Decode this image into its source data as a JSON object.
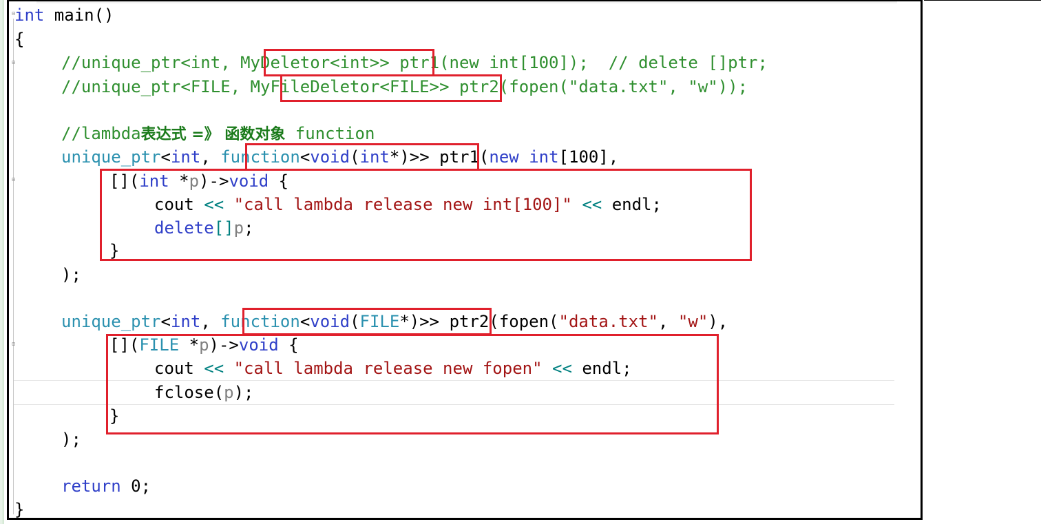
{
  "editor": {
    "language": "cpp",
    "lines": {
      "l1": {
        "kw": "int",
        "rest": " main()"
      },
      "l2": {
        "text": "{"
      },
      "l3": {
        "c1": "//unique_ptr<int, ",
        "c2": "MyDeletor<int>",
        "c3": "> ptr1(new int[100]);  // delete []ptr;"
      },
      "l4": {
        "c1": "//unique_ptr<FILE, ",
        "c2": "MyFileDeletor<FILE>",
        "c3": "> ptr2(fopen(\"data.txt\", \"w\"));"
      },
      "l5": {
        "c1": "//lambda",
        "cj": "表达式 =》 函数对象",
        "c3": " function"
      },
      "l6": {
        "t1": "unique_ptr",
        "p1": "<",
        "k1": "int",
        "p2": ", ",
        "t2": "function",
        "p3": "<",
        "k2": "void",
        "p4": "(",
        "k3": "int",
        "p5": "*)",
        "p6": ">> ptr1(",
        "k4": "new",
        "p7": " ",
        "k5": "int",
        "p8": "[100],"
      },
      "l7": {
        "p1": "[](",
        "k1": "int",
        "p2": " *",
        "pr": "p",
        "p3": ")->",
        "k2": "void",
        "p4": " {"
      },
      "l8": {
        "p1": "cout ",
        "o1": "<<",
        "p2": " ",
        "s1": "\"call lambda release new int[100]\"",
        "p3": " ",
        "o2": "<<",
        "p4": " endl;"
      },
      "l9": {
        "k1": "delete",
        "o1": "[]",
        "pr": "p",
        "p1": ";"
      },
      "l10": {
        "text": "}"
      },
      "l11": {
        "text": ");"
      },
      "l12": {
        "t1": "unique_ptr",
        "p1": "<",
        "k1": "int",
        "p2": ", ",
        "t2": "function",
        "p3": "<",
        "k2": "void",
        "p4": "(",
        "t3": "FILE",
        "p5": "*)",
        "p6": ">> ptr2(fopen(",
        "s1": "\"data.txt\"",
        "p7": ", ",
        "s2": "\"w\"",
        "p8": "),"
      },
      "l13": {
        "p1": "[](",
        "t1": "FILE",
        "p2": " *",
        "pr": "p",
        "p3": ")->",
        "k1": "void",
        "p4": " {"
      },
      "l14": {
        "p1": "cout ",
        "o1": "<<",
        "p2": " ",
        "s1": "\"call lambda release new fopen\"",
        "p3": " ",
        "o2": "<<",
        "p4": " endl;"
      },
      "l15": {
        "p1": "fclose(",
        "pr": "p",
        "p2": ");"
      },
      "l16": {
        "text": "}"
      },
      "l17": {
        "text": ");"
      },
      "l18": {
        "k1": "return",
        "p1": " 0;"
      },
      "l19": {
        "text": "}"
      }
    }
  },
  "colors": {
    "keyword": "#2f3fc8",
    "type": "#2b91af",
    "comment": "#2f8f2f",
    "string": "#a31515",
    "operator": "#008080",
    "parameter": "#808080",
    "highlight_box": "#e0202c"
  }
}
